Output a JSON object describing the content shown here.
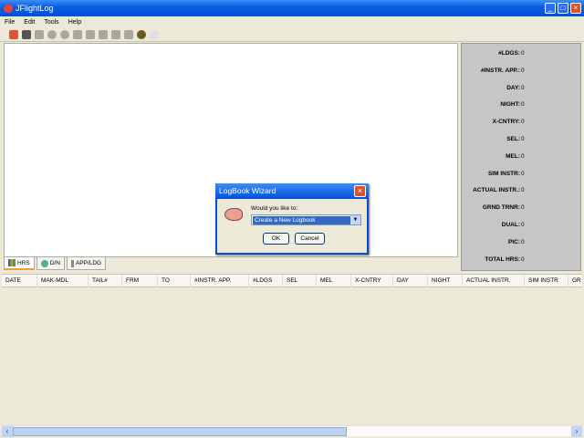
{
  "window": {
    "title": "JFlightLog"
  },
  "menu": [
    "File",
    "Edit",
    "Tools",
    "Help"
  ],
  "toolbar": {
    "icons": [
      "open-logbook-icon",
      "save-icon",
      "grid-icon",
      "circle-icon",
      "circle-icon",
      "wrench-icon",
      "printer-icon",
      "page-icon",
      "pen-icon",
      "folder-icon",
      "globe-icon",
      "bulb-icon"
    ]
  },
  "stats": [
    {
      "label": "#LDGS:",
      "value": "0"
    },
    {
      "label": "#INSTR. APP.:",
      "value": "0"
    },
    {
      "label": "DAY:",
      "value": "0"
    },
    {
      "label": "NIGHT:",
      "value": "0"
    },
    {
      "label": "X-CNTRY:",
      "value": "0"
    },
    {
      "label": "SEL:",
      "value": "0"
    },
    {
      "label": "MEL:",
      "value": "0"
    },
    {
      "label": "SIM INSTR:",
      "value": "0"
    },
    {
      "label": "ACTUAL INSTR.:",
      "value": "0"
    },
    {
      "label": "GRND TRNR:",
      "value": "0"
    },
    {
      "label": "DUAL:",
      "value": "0"
    },
    {
      "label": "PIC:",
      "value": "0"
    },
    {
      "label": "TOTAL HRS:",
      "value": "0"
    }
  ],
  "tabs": [
    {
      "label": "HRS"
    },
    {
      "label": "D/N"
    },
    {
      "label": "APP/LDG"
    }
  ],
  "table": {
    "columns": [
      "DATE",
      "MAK-MDL",
      "TAIL#",
      "FRM",
      "TO",
      "#INSTR. APP.",
      "#LDGS",
      "SEL",
      "MEL",
      "X-CNTRY",
      "DAY",
      "NIGHT",
      "ACTUAL INSTR.",
      "SIM INSTR",
      "GR"
    ]
  },
  "dialog": {
    "title": "LogBook Wizard",
    "prompt": "Would you like to:",
    "selected": "Create a New Logbook",
    "ok": "OK",
    "cancel": "Cancel"
  }
}
